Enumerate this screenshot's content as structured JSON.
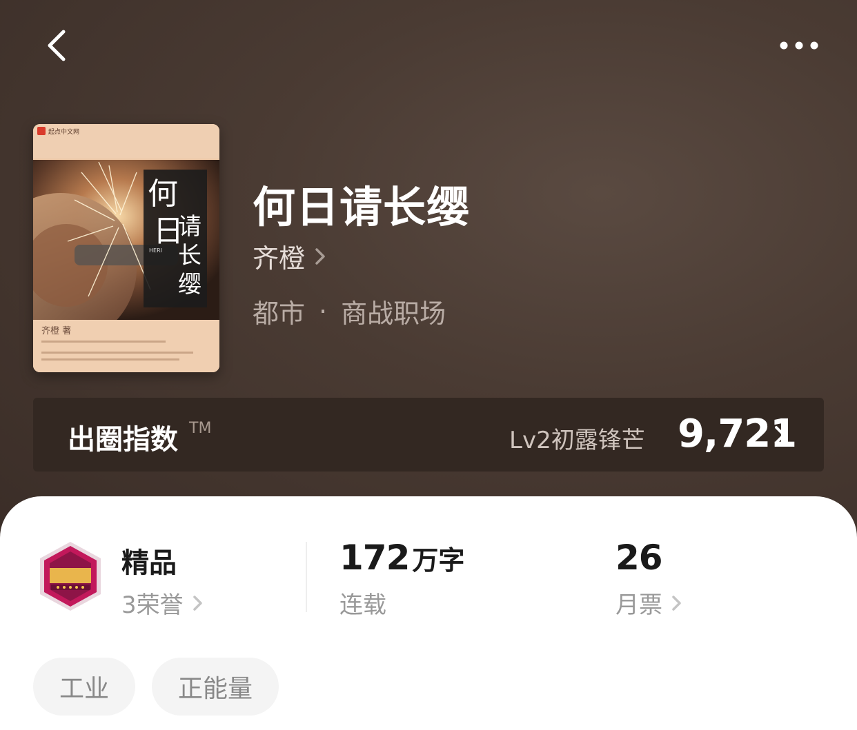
{
  "book": {
    "title": "何日请长缨",
    "author": "齐橙",
    "category": "都市",
    "subcategory": "商战职场",
    "separator": "·"
  },
  "cover": {
    "publisher": "起点中文网",
    "title_chars": [
      "何",
      "日",
      "请",
      "长",
      "缨"
    ],
    "latin": "HERI",
    "author_line": "齐橙 著"
  },
  "breakout_index": {
    "label": "出圈指数",
    "tm": "TM",
    "level": "Lv2初露锋芒",
    "score": "9,721"
  },
  "stats": {
    "quality": {
      "title": "精品",
      "sub": "3荣誉"
    },
    "words": {
      "number": "172",
      "unit": "万字",
      "status": "连载"
    },
    "monthly_tickets": {
      "value": "26",
      "label": "月票"
    }
  },
  "tags": [
    "工业",
    "正能量"
  ],
  "colors": {
    "hero_bg": "#4a3b33",
    "index_bar": "#332822",
    "badge": "#c2185b",
    "tag_bg": "#f4f4f4"
  },
  "icons": {
    "back": "chevron-left-icon",
    "more": "more-dots-icon",
    "chevron": "chevron-right-icon",
    "badge": "premium-channel-badge-icon"
  }
}
